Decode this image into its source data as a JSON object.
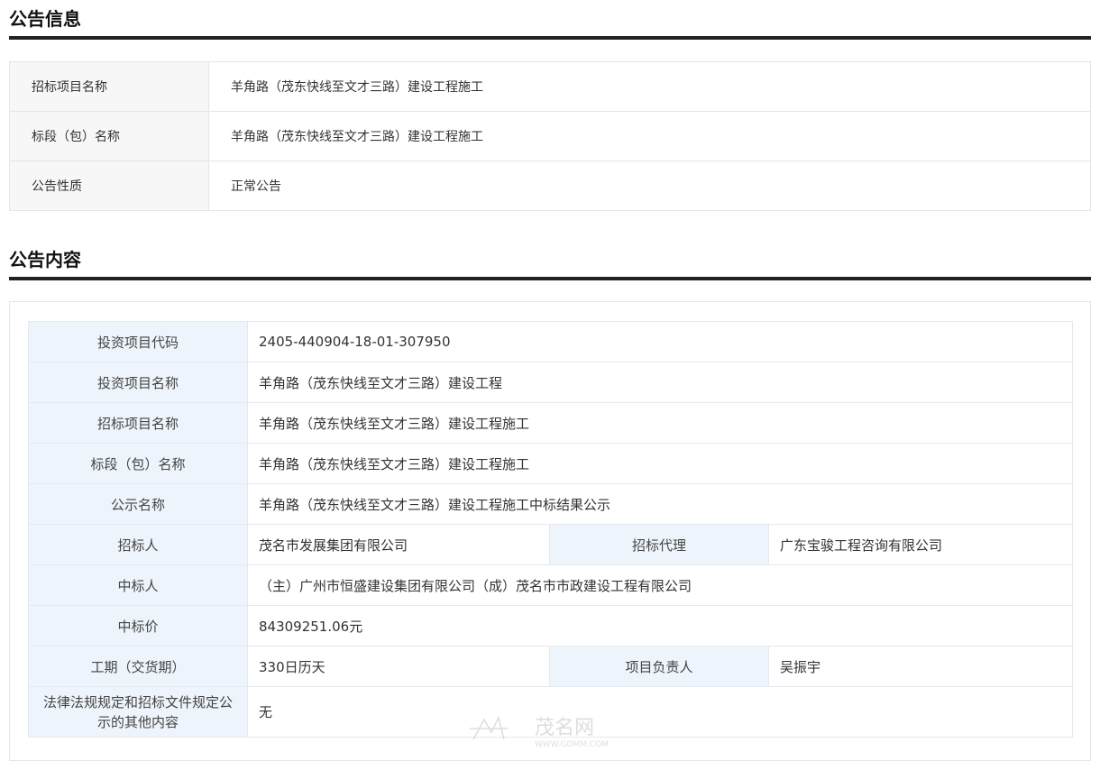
{
  "announcement_info": {
    "title": "公告信息",
    "rows": [
      {
        "label": "招标项目名称",
        "value": "羊角路（茂东快线至文才三路）建设工程施工"
      },
      {
        "label": "标段（包）名称",
        "value": "羊角路（茂东快线至文才三路）建设工程施工"
      },
      {
        "label": "公告性质",
        "value": "正常公告"
      }
    ]
  },
  "announcement_content": {
    "title": "公告内容",
    "investment_code": {
      "label": "投资项目代码",
      "value": "2405-440904-18-01-307950"
    },
    "investment_name": {
      "label": "投资项目名称",
      "value": "羊角路（茂东快线至文才三路）建设工程"
    },
    "tender_name": {
      "label": "招标项目名称",
      "value": "羊角路（茂东快线至文才三路）建设工程施工"
    },
    "section_name": {
      "label": "标段（包）名称",
      "value": "羊角路（茂东快线至文才三路）建设工程施工"
    },
    "notice_name": {
      "label": "公示名称",
      "value": "羊角路（茂东快线至文才三路）建设工程施工中标结果公示"
    },
    "tenderer": {
      "label": "招标人",
      "value": "茂名市发展集团有限公司"
    },
    "agent": {
      "label": "招标代理",
      "value": "广东宝骏工程咨询有限公司"
    },
    "winner": {
      "label": "中标人",
      "value": "（主）广州市恒盛建设集团有限公司（成）茂名市市政建设工程有限公司"
    },
    "price": {
      "label": "中标价",
      "value": "84309251.06元"
    },
    "duration": {
      "label": "工期（交货期）",
      "value": "330日历天"
    },
    "manager": {
      "label": "项目负责人",
      "value": "吴振宇"
    },
    "other": {
      "label": "法律法规规定和招标文件规定公示的其他内容",
      "value": "无"
    }
  },
  "watermark": {
    "text": "茂名网",
    "url": "WWW.GDMM.COM"
  }
}
